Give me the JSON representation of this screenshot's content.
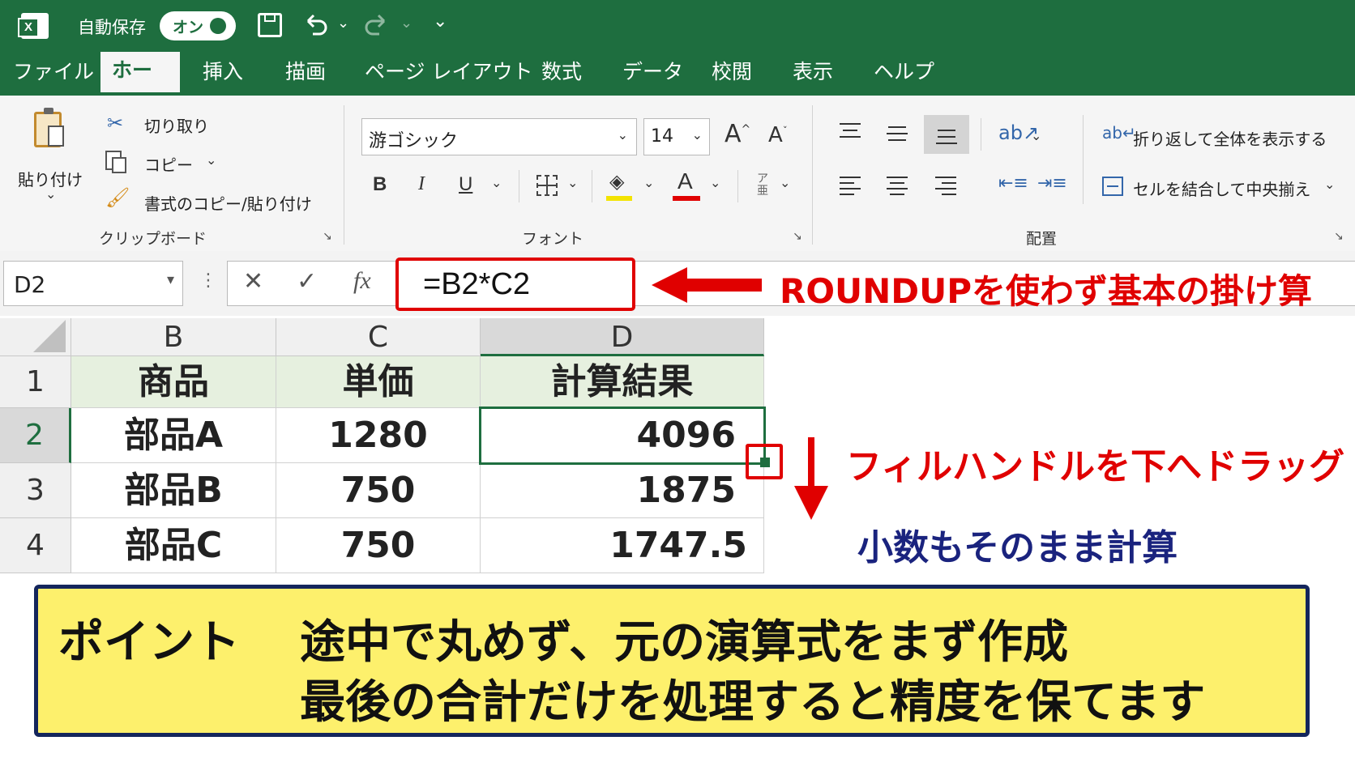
{
  "titlebar": {
    "autosave_label": "自動保存",
    "autosave_toggle": "オン"
  },
  "menu": [
    "ファイル",
    "ホーム",
    "挿入",
    "描画",
    "ページ レイアウト",
    "数式",
    "データ",
    "校閲",
    "表示",
    "ヘルプ"
  ],
  "ribbon": {
    "clipboard": {
      "paste": "貼り付け",
      "cut": "切り取り",
      "copy": "コピー",
      "format_painter": "書式のコピー/貼り付け",
      "group_label": "クリップボード"
    },
    "font": {
      "font_name": "游ゴシック",
      "font_size": "14",
      "bold": "B",
      "italic": "I",
      "underline": "U",
      "font_color_glyph": "A",
      "group_label": "フォント"
    },
    "alignment": {
      "wrap_text": "折り返して全体を表示する",
      "merge_center": "セルを結合して中央揃え",
      "group_label": "配置"
    }
  },
  "formula_bar": {
    "name_box": "D2",
    "fx": "fx",
    "formula": "=B2*C2"
  },
  "sheet": {
    "columns": [
      "B",
      "C",
      "D"
    ],
    "rows": [
      "1",
      "2",
      "3",
      "4"
    ],
    "header_row": [
      "商品",
      "単価",
      "計算結果"
    ],
    "data_rows": [
      [
        "部品A",
        "1280",
        "4096"
      ],
      [
        "部品B",
        "750",
        "1875"
      ],
      [
        "部品C",
        "750",
        "1747.5"
      ]
    ]
  },
  "annotations": {
    "formula_note": "ROUNDUPを使わず基本の掛け算",
    "fill_handle_note": "フィルハンドルを下へドラッグ",
    "decimal_note": "小数もそのまま計算"
  },
  "point_box": {
    "label": "ポイント",
    "line1": "途中で丸めず、元の演算式をまず作成",
    "line2": "最後の合計だけを処理すると精度を保てます"
  },
  "colors": {
    "excel_green": "#1e6e3f",
    "annotation_red": "#e00000",
    "annotation_navy": "#1a237e",
    "point_yellow": "#fdf06c"
  }
}
